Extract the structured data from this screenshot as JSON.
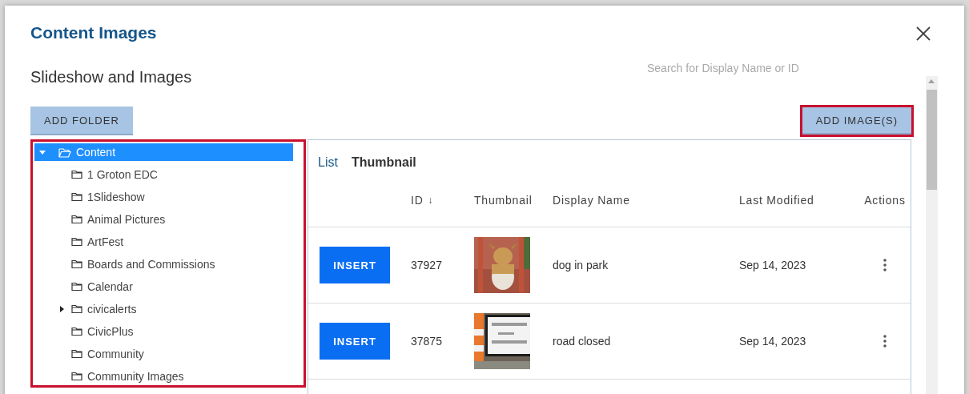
{
  "dialog": {
    "title": "Content Images",
    "subtitle": "Slideshow and Images",
    "search": {
      "placeholder": "Search for Display Name or ID"
    },
    "buttons": [
      {
        "label": "ADD FOLDER",
        "highlighted": false
      },
      {
        "label": "ADD IMAGE(S)",
        "highlighted": true
      }
    ]
  },
  "folder_tree": {
    "highlighted": true,
    "items": [
      {
        "label": "Content",
        "selected": true,
        "expanded": true,
        "has_children": true,
        "children": [
          {
            "label": "1 Groton EDC",
            "selected": false,
            "expanded": false,
            "has_children": false
          },
          {
            "label": "1Slideshow",
            "selected": false,
            "expanded": false,
            "has_children": false
          },
          {
            "label": "Animal Pictures",
            "selected": false,
            "expanded": false,
            "has_children": false
          },
          {
            "label": "ArtFest",
            "selected": false,
            "expanded": false,
            "has_children": false
          },
          {
            "label": "Boards and Commissions",
            "selected": false,
            "expanded": false,
            "has_children": false
          },
          {
            "label": "Calendar",
            "selected": false,
            "expanded": false,
            "has_children": false
          },
          {
            "label": "civicalerts",
            "selected": false,
            "expanded": false,
            "has_children": true
          },
          {
            "label": "CivicPlus",
            "selected": false,
            "expanded": false,
            "has_children": false
          },
          {
            "label": "Community",
            "selected": false,
            "expanded": false,
            "has_children": false
          },
          {
            "label": "Community Images",
            "selected": false,
            "expanded": false,
            "has_children": false
          }
        ]
      }
    ]
  },
  "view_tabs": [
    {
      "label": "List",
      "selected": false
    },
    {
      "label": "Thumbnail",
      "selected": true
    }
  ],
  "table": {
    "columns": [
      {
        "label": "ID",
        "sort": "↓"
      },
      {
        "label": "Thumbnail"
      },
      {
        "label": "Display Name"
      },
      {
        "label": "Last Modified"
      },
      {
        "label": "Actions"
      }
    ],
    "rows": [
      {
        "action": "INSERT",
        "id": "37927",
        "name": "dog in park",
        "modified": "Sep 14, 2023"
      },
      {
        "action": "INSERT",
        "id": "37875",
        "name": "road closed",
        "modified": "Sep 14, 2023"
      }
    ]
  }
}
